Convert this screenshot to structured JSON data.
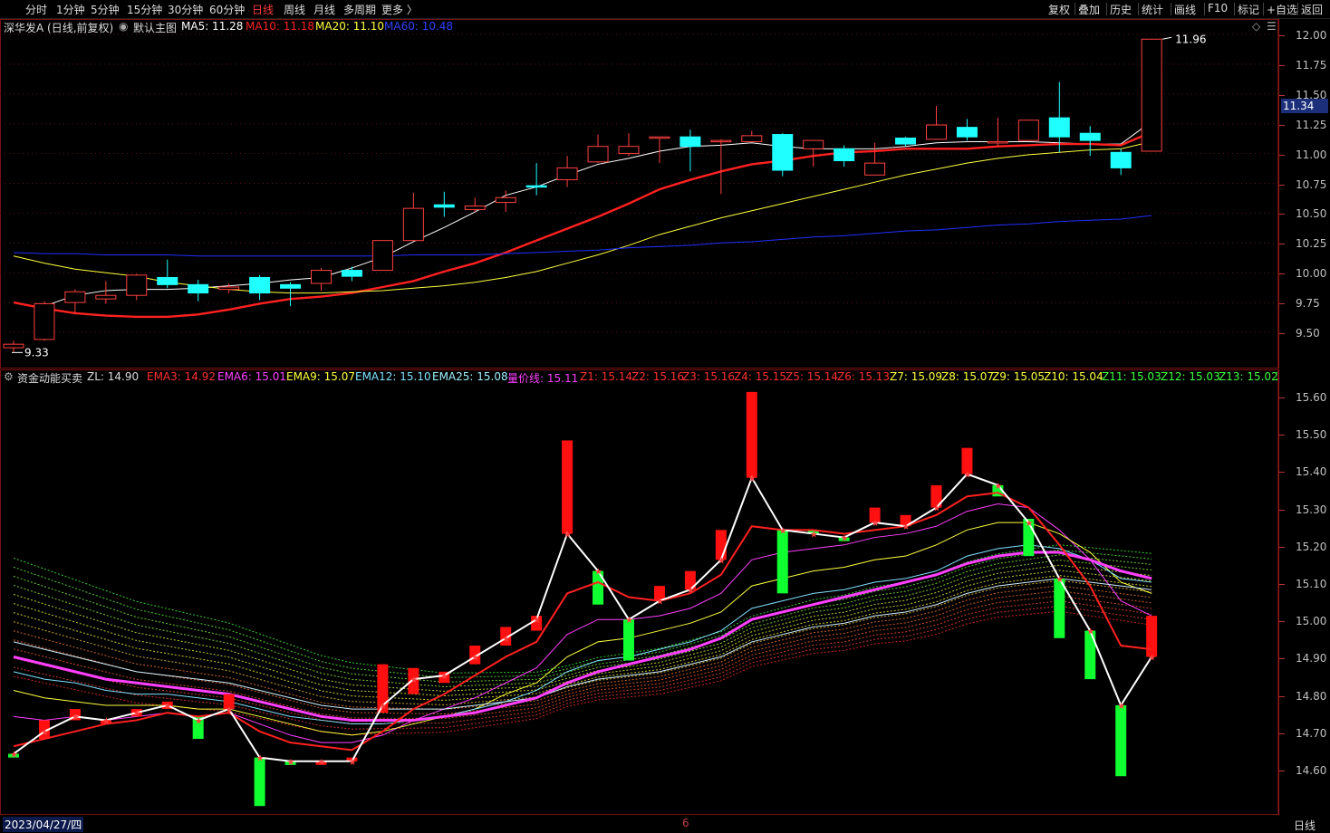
{
  "toolbar": {
    "periods": [
      "分时",
      "1分钟",
      "5分钟",
      "15分钟",
      "30分钟",
      "60分钟",
      "日线",
      "周线",
      "月线",
      "多周期",
      "更多 〉"
    ],
    "active_period": "日线",
    "right_tools": [
      "复权",
      "叠加",
      "历史",
      "统计",
      "画线",
      "F10",
      "标记",
      "+自选",
      "返回"
    ]
  },
  "main_panel": {
    "stock_title": "深华发A (日线,前复权)",
    "template_label": "默认主图",
    "ma": [
      {
        "label": "MA5: 11.28",
        "color": "#ffffff"
      },
      {
        "label": "MA10: 11.18",
        "color": "#ff2020"
      },
      {
        "label": "MA20: 11.10",
        "color": "#ffff40"
      },
      {
        "label": "MA60: 10.48",
        "color": "#3040ff"
      }
    ],
    "high_marker": "11.96",
    "low_marker": "9.33",
    "current_price": "11.34"
  },
  "sub_panel": {
    "indicator_title": "资金动能买卖",
    "indicator_value": "ZL: 14.90",
    "lines": [
      {
        "label": "EMA3: 14.92",
        "color": "#ff3030"
      },
      {
        "label": "EMA6: 15.01",
        "color": "#ff40ff"
      },
      {
        "label": "EMA9: 15.07",
        "color": "#ffff40"
      },
      {
        "label": "EMA12: 15.10",
        "color": "#80e0ff"
      },
      {
        "label": "EMA25: 15.08",
        "color": "#a0f0ff"
      },
      {
        "label": "量价线: 15.11",
        "color": "#ff40ff"
      },
      {
        "label": "Z1: 15.14",
        "color": "#ff3030"
      },
      {
        "label": "Z2: 15.16",
        "color": "#ff3030"
      },
      {
        "label": "Z3: 15.16",
        "color": "#ff3030"
      },
      {
        "label": "Z4: 15.15",
        "color": "#ff3030"
      },
      {
        "label": "Z5: 15.14",
        "color": "#ff3030"
      },
      {
        "label": "Z6: 15.13",
        "color": "#ff3030"
      },
      {
        "label": "Z7: 15.09",
        "color": "#ffff40"
      },
      {
        "label": "Z8: 15.07",
        "color": "#ffff40"
      },
      {
        "label": "Z9: 15.05",
        "color": "#ffff40"
      },
      {
        "label": "Z10: 15.04",
        "color": "#ffff40"
      },
      {
        "label": "Z11: 15.03",
        "color": "#40ff40"
      },
      {
        "label": "Z12: 15.03",
        "color": "#40ff40"
      },
      {
        "label": "Z13: 15.02",
        "color": "#40ff40"
      },
      {
        "label": "Z",
        "color": "#40ff40"
      }
    ]
  },
  "price_axis": [
    "12.00",
    "11.75",
    "11.50",
    "11.25",
    "11.00",
    "10.75",
    "10.50",
    "10.25",
    "10.00",
    "9.75",
    "9.50"
  ],
  "indicator_axis": [
    "15.60",
    "15.50",
    "15.40",
    "15.30",
    "15.20",
    "15.10",
    "15.00",
    "14.90",
    "14.80",
    "14.70",
    "14.60"
  ],
  "footer": {
    "date": "2023/04/27/四",
    "month_marker": "6",
    "period": "日线"
  },
  "chart_data": [
    {
      "type": "candlestick",
      "ylim": [
        9.33,
        12.06
      ],
      "candles": [
        [
          9.37,
          9.4,
          9.33,
          9.43
        ],
        [
          9.44,
          9.74,
          9.43,
          9.76
        ],
        [
          9.75,
          9.84,
          9.65,
          9.86
        ],
        [
          9.78,
          9.81,
          9.74,
          9.93
        ],
        [
          9.81,
          9.98,
          9.77,
          9.99
        ],
        [
          9.96,
          9.9,
          9.87,
          10.11
        ],
        [
          9.9,
          9.83,
          9.76,
          9.94
        ],
        [
          9.86,
          9.88,
          9.83,
          9.91
        ],
        [
          9.96,
          9.83,
          9.77,
          9.98
        ],
        [
          9.9,
          9.87,
          9.72,
          9.92
        ],
        [
          9.91,
          10.02,
          9.85,
          10.04
        ],
        [
          10.02,
          9.97,
          9.93,
          10.05
        ],
        [
          10.02,
          10.27,
          10.02,
          10.27
        ],
        [
          10.27,
          10.54,
          10.28,
          10.67
        ],
        [
          10.57,
          10.55,
          10.47,
          10.68
        ],
        [
          10.53,
          10.56,
          10.51,
          10.63
        ],
        [
          10.59,
          10.63,
          10.51,
          10.69
        ],
        [
          10.73,
          10.72,
          10.65,
          10.92
        ],
        [
          10.78,
          10.88,
          10.72,
          10.98
        ],
        [
          10.93,
          11.06,
          10.92,
          11.16
        ],
        [
          11.0,
          11.06,
          10.98,
          11.17
        ],
        [
          11.13,
          11.14,
          10.92,
          11.14
        ],
        [
          11.14,
          11.06,
          10.85,
          11.2
        ],
        [
          11.1,
          11.11,
          10.66,
          11.12
        ],
        [
          11.1,
          11.15,
          11.1,
          11.19
        ],
        [
          11.16,
          10.86,
          10.81,
          11.17
        ],
        [
          11.04,
          11.11,
          10.89,
          11.11
        ],
        [
          11.04,
          10.94,
          10.89,
          11.07
        ],
        [
          10.82,
          10.92,
          10.82,
          11.09
        ],
        [
          11.13,
          11.08,
          11.06,
          11.14
        ],
        [
          11.12,
          11.24,
          11.12,
          11.4
        ],
        [
          11.22,
          11.14,
          11.11,
          11.29
        ],
        [
          11.09,
          11.1,
          11.06,
          11.3
        ],
        [
          11.11,
          11.28,
          11.11,
          11.28
        ],
        [
          11.3,
          11.14,
          11.01,
          11.6
        ],
        [
          11.17,
          11.11,
          10.98,
          11.23
        ],
        [
          11.01,
          10.88,
          10.82,
          11.04
        ],
        [
          11.02,
          11.96,
          11.02,
          11.96
        ]
      ],
      "series": [
        {
          "name": "MA5",
          "values": [
            null,
            9.72,
            9.81,
            9.85,
            9.86,
            9.86,
            9.87,
            9.89,
            9.91,
            9.94,
            9.96,
            10.04,
            10.13,
            10.26,
            10.38,
            10.51,
            10.65,
            10.72,
            10.82,
            10.91,
            10.96,
            11.02,
            11.06,
            11.07,
            11.09,
            11.06,
            11.04,
            11.04,
            11.04,
            11.06,
            11.09,
            11.1,
            11.1,
            11.1,
            11.09,
            11.08,
            11.08,
            11.27
          ]
        },
        {
          "name": "MA10",
          "values": [
            9.75,
            9.7,
            9.66,
            9.64,
            9.63,
            9.63,
            9.65,
            9.69,
            9.74,
            9.78,
            9.8,
            9.83,
            9.88,
            9.93,
            10.01,
            10.08,
            10.17,
            10.27,
            10.37,
            10.47,
            10.58,
            10.7,
            10.78,
            10.85,
            10.91,
            10.94,
            10.98,
            11.01,
            11.02,
            11.04,
            11.04,
            11.04,
            11.06,
            11.07,
            11.08,
            11.08,
            11.07,
            11.18
          ]
        },
        {
          "name": "MA20",
          "values": [
            10.14,
            10.08,
            10.03,
            10.0,
            9.97,
            9.92,
            9.89,
            9.86,
            9.84,
            9.83,
            9.83,
            9.84,
            9.85,
            9.87,
            9.89,
            9.92,
            9.96,
            10.01,
            10.08,
            10.15,
            10.23,
            10.32,
            10.39,
            10.46,
            10.52,
            10.58,
            10.64,
            10.7,
            10.76,
            10.82,
            10.87,
            10.92,
            10.96,
            10.99,
            11.01,
            11.03,
            11.04,
            11.1
          ]
        },
        {
          "name": "MA60",
          "values": [
            10.17,
            10.16,
            10.16,
            10.15,
            10.15,
            10.15,
            10.14,
            10.14,
            10.14,
            10.14,
            10.14,
            10.14,
            10.14,
            10.15,
            10.15,
            10.15,
            10.16,
            10.17,
            10.18,
            10.19,
            10.21,
            10.22,
            10.23,
            10.25,
            10.26,
            10.28,
            10.3,
            10.31,
            10.33,
            10.35,
            10.36,
            10.38,
            10.4,
            10.41,
            10.43,
            10.44,
            10.45,
            10.48
          ]
        }
      ]
    },
    {
      "type": "bar",
      "ylim": [
        14.52,
        15.62
      ],
      "bars": [
        [
          14.64,
          14.63,
          "green"
        ],
        [
          14.68,
          14.73,
          "red"
        ],
        [
          14.73,
          14.76,
          "red"
        ],
        [
          14.72,
          14.73,
          "red"
        ],
        [
          14.74,
          14.76,
          "red"
        ],
        [
          14.76,
          14.78,
          "red"
        ],
        [
          14.74,
          14.68,
          "green"
        ],
        [
          14.76,
          14.8,
          "red"
        ],
        [
          14.63,
          14.5,
          "green"
        ],
        [
          14.61,
          14.62,
          "green"
        ],
        [
          14.62,
          14.62,
          "red"
        ],
        [
          14.62,
          14.63,
          "red"
        ],
        [
          14.75,
          14.88,
          "red"
        ],
        [
          14.8,
          14.87,
          "red"
        ],
        [
          14.83,
          14.86,
          "red"
        ],
        [
          14.88,
          14.93,
          "red"
        ],
        [
          14.93,
          14.98,
          "red"
        ],
        [
          14.97,
          15.01,
          "red"
        ],
        [
          15.23,
          15.48,
          "red"
        ],
        [
          15.13,
          15.04,
          "green"
        ],
        [
          15.0,
          14.89,
          "green"
        ],
        [
          15.05,
          15.09,
          "red"
        ],
        [
          15.08,
          15.13,
          "red"
        ],
        [
          15.16,
          15.24,
          "red"
        ],
        [
          15.38,
          15.61,
          "red"
        ],
        [
          15.24,
          15.07,
          "green"
        ],
        [
          15.23,
          15.24,
          "green"
        ],
        [
          15.22,
          15.21,
          "green"
        ],
        [
          15.26,
          15.3,
          "red"
        ],
        [
          15.25,
          15.28,
          "red"
        ],
        [
          15.3,
          15.36,
          "red"
        ],
        [
          15.39,
          15.46,
          "red"
        ],
        [
          15.36,
          15.33,
          "green"
        ],
        [
          15.27,
          15.17,
          "green"
        ],
        [
          15.11,
          14.95,
          "green"
        ],
        [
          14.97,
          14.84,
          "green"
        ],
        [
          14.77,
          14.58,
          "green"
        ],
        [
          14.9,
          15.01,
          "red"
        ]
      ],
      "series": [
        {
          "name": "ZL",
          "values": [
            14.64,
            14.7,
            14.74,
            14.73,
            14.75,
            14.77,
            14.73,
            14.76,
            14.63,
            14.62,
            14.62,
            14.62,
            14.77,
            14.84,
            14.85,
            14.9,
            14.95,
            15.0,
            15.23,
            15.13,
            15.0,
            15.05,
            15.08,
            15.16,
            15.38,
            15.24,
            15.23,
            15.22,
            15.26,
            15.25,
            15.3,
            15.39,
            15.36,
            15.26,
            15.11,
            14.97,
            14.77,
            14.9
          ]
        },
        {
          "name": "EMA3",
          "values": [
            14.66,
            14.68,
            14.7,
            14.72,
            14.73,
            14.75,
            14.74,
            14.75,
            14.7,
            14.67,
            14.66,
            14.65,
            14.7,
            14.76,
            14.8,
            14.85,
            14.9,
            14.94,
            15.07,
            15.1,
            15.06,
            15.05,
            15.07,
            15.12,
            15.25,
            15.24,
            15.24,
            15.23,
            15.24,
            15.25,
            15.28,
            15.33,
            15.34,
            15.3,
            15.2,
            15.09,
            14.93,
            14.92
          ]
        },
        {
          "name": "EMA6",
          "values": [
            14.74,
            14.73,
            14.74,
            14.73,
            14.74,
            14.75,
            14.74,
            14.75,
            14.72,
            14.69,
            14.67,
            14.67,
            14.69,
            14.73,
            14.76,
            14.79,
            14.83,
            14.87,
            14.96,
            15.0,
            15.0,
            15.01,
            15.03,
            15.07,
            15.16,
            15.18,
            15.19,
            15.2,
            15.22,
            15.23,
            15.25,
            15.29,
            15.31,
            15.3,
            15.24,
            15.16,
            15.05,
            15.01
          ]
        },
        {
          "name": "EMA9",
          "values": [
            14.81,
            14.79,
            14.78,
            14.77,
            14.77,
            14.77,
            14.76,
            14.76,
            14.74,
            14.72,
            14.7,
            14.69,
            14.7,
            14.72,
            14.74,
            14.76,
            14.8,
            14.83,
            14.9,
            14.94,
            14.95,
            14.97,
            14.99,
            15.02,
            15.09,
            15.11,
            15.13,
            15.14,
            15.16,
            15.17,
            15.2,
            15.24,
            15.26,
            15.26,
            15.23,
            15.18,
            15.1,
            15.07
          ]
        },
        {
          "name": "EMA12",
          "values": [
            14.86,
            14.84,
            14.83,
            14.81,
            14.8,
            14.8,
            14.79,
            14.78,
            14.76,
            14.74,
            14.73,
            14.72,
            14.72,
            14.73,
            14.74,
            14.76,
            14.78,
            14.81,
            14.86,
            14.89,
            14.9,
            14.92,
            14.94,
            14.97,
            15.03,
            15.05,
            15.07,
            15.08,
            15.1,
            15.11,
            15.13,
            15.17,
            15.19,
            15.2,
            15.19,
            15.16,
            15.11,
            15.1
          ]
        },
        {
          "name": "EMA25",
          "values": [
            14.94,
            14.92,
            14.9,
            14.88,
            14.86,
            14.85,
            14.84,
            14.83,
            14.81,
            14.79,
            14.77,
            14.76,
            14.76,
            14.76,
            14.76,
            14.77,
            14.78,
            14.79,
            14.82,
            14.84,
            14.85,
            14.86,
            14.88,
            14.9,
            14.94,
            14.96,
            14.98,
            14.99,
            15.01,
            15.02,
            15.04,
            15.07,
            15.09,
            15.1,
            15.11,
            15.1,
            15.09,
            15.08
          ]
        },
        {
          "name": "量价线",
          "values": [
            14.9,
            14.88,
            14.86,
            14.84,
            14.83,
            14.82,
            14.81,
            14.8,
            14.78,
            14.76,
            14.74,
            14.73,
            14.73,
            14.73,
            14.74,
            14.75,
            14.77,
            14.79,
            14.83,
            14.86,
            14.88,
            14.9,
            14.92,
            14.95,
            15.0,
            15.02,
            15.04,
            15.06,
            15.08,
            15.1,
            15.12,
            15.15,
            15.17,
            15.18,
            15.18,
            15.16,
            15.13,
            15.11
          ]
        }
      ]
    }
  ]
}
